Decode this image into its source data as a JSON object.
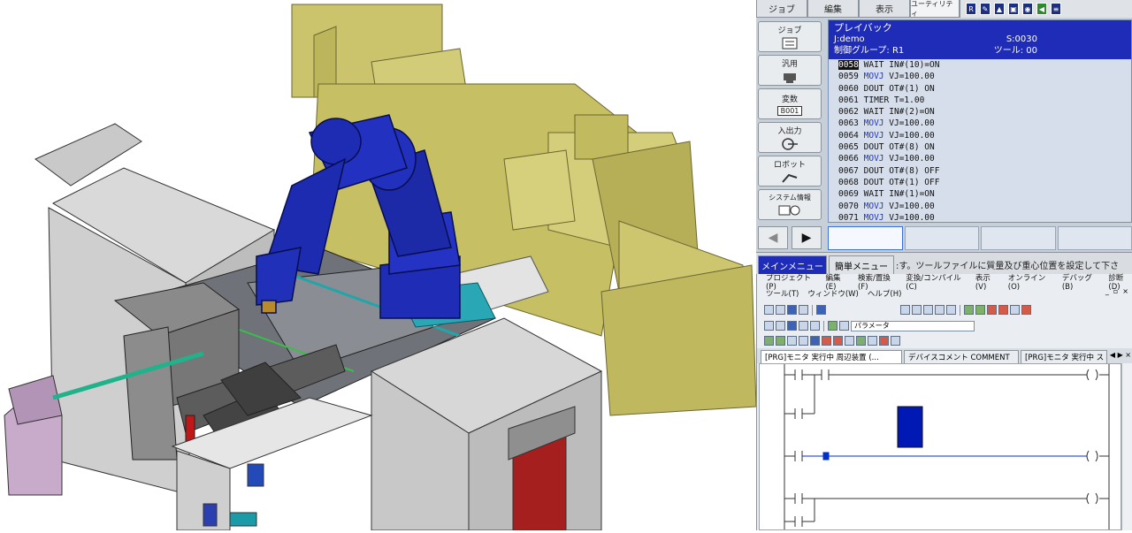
{
  "pendant": {
    "tabs": [
      "ジョブ",
      "編集",
      "表示",
      "ユーティリティ"
    ],
    "toolbar_icons": [
      "robot-icon",
      "edit-icon",
      "signal-icon",
      "lock-icon",
      "camera-icon",
      "back-icon",
      "menu-icon"
    ],
    "menu_buttons": [
      {
        "label": "ジョブ",
        "icon": "job-icon"
      },
      {
        "label": "汎用",
        "icon": "general-icon"
      },
      {
        "label": "変数",
        "icon": "variable-icon",
        "sub": "B001"
      },
      {
        "label": "入出力",
        "icon": "io-icon"
      },
      {
        "label": "ロボット",
        "icon": "robot-arm-icon"
      },
      {
        "label": "システム情報",
        "icon": "system-info-icon"
      }
    ],
    "header": {
      "mode": "プレイバック",
      "job": "J:demo",
      "step": "S:0030",
      "group": "制御グループ: R1",
      "tool": "ツール: 00"
    },
    "program_lines": [
      {
        "no": "0058",
        "instr": "WAIT",
        "args": "IN#(10)=ON",
        "selected": true
      },
      {
        "no": "0059",
        "instr": "MOVJ",
        "args": "VJ=100.00",
        "selected": false
      },
      {
        "no": "0060",
        "instr": "DOUT",
        "args": "OT#(1) ON",
        "selected": false
      },
      {
        "no": "0061",
        "instr": "TIMER",
        "args": "T=1.00",
        "selected": false
      },
      {
        "no": "0062",
        "instr": "WAIT",
        "args": "IN#(2)=ON",
        "selected": false
      },
      {
        "no": "0063",
        "instr": "MOVJ",
        "args": "VJ=100.00",
        "selected": false
      },
      {
        "no": "0064",
        "instr": "MOVJ",
        "args": "VJ=100.00",
        "selected": false
      },
      {
        "no": "0065",
        "instr": "DOUT",
        "args": "OT#(8) ON",
        "selected": false
      },
      {
        "no": "0066",
        "instr": "MOVJ",
        "args": "VJ=100.00",
        "selected": false
      },
      {
        "no": "0067",
        "instr": "DOUT",
        "args": "OT#(8) OFF",
        "selected": false
      },
      {
        "no": "0068",
        "instr": "DOUT",
        "args": "OT#(1) OFF",
        "selected": false
      },
      {
        "no": "0069",
        "instr": "WAIT",
        "args": "IN#(1)=ON",
        "selected": false
      },
      {
        "no": "0070",
        "instr": "MOVJ",
        "args": "VJ=100.00",
        "selected": false
      },
      {
        "no": "0071",
        "instr": "MOVJ",
        "args": "VJ=100.00",
        "selected": false
      }
    ],
    "nav": {
      "back": "◀",
      "forward": "▶"
    }
  },
  "menubar": {
    "main_menu": "メインメニュー",
    "simple_menu": "簡単メニュー",
    "status": ":す。ツールファイルに質量及び重心位置を設定して下さ"
  },
  "gx": {
    "menu_row1": [
      "プロジェクト(P)",
      "編集(E)",
      "検索/置換(F)",
      "変換/コンパイル(C)",
      "表示(V)",
      "オンライン(O)",
      "デバッグ(B)",
      "診断(D)"
    ],
    "menu_row2": [
      "ツール(T)",
      "ウィンドウ(W)",
      "ヘルプ(H)"
    ],
    "window_controls": [
      "_",
      "▫",
      "×"
    ],
    "param_field": "パラメータ",
    "tabs": [
      {
        "label": "[PRG]モニタ 実行中 周辺装置 (...",
        "active": true
      },
      {
        "label": "デバイスコメント COMMENT",
        "active": false
      },
      {
        "label": "[PRG]モニタ 実行中 ストッカー(…",
        "active": false
      }
    ]
  },
  "colors": {
    "robot_blue": "#1e2cb8",
    "cabinet_yellow": "#c9c266",
    "pendant_header": "#1e2cb8",
    "selected_line": "#111111"
  }
}
